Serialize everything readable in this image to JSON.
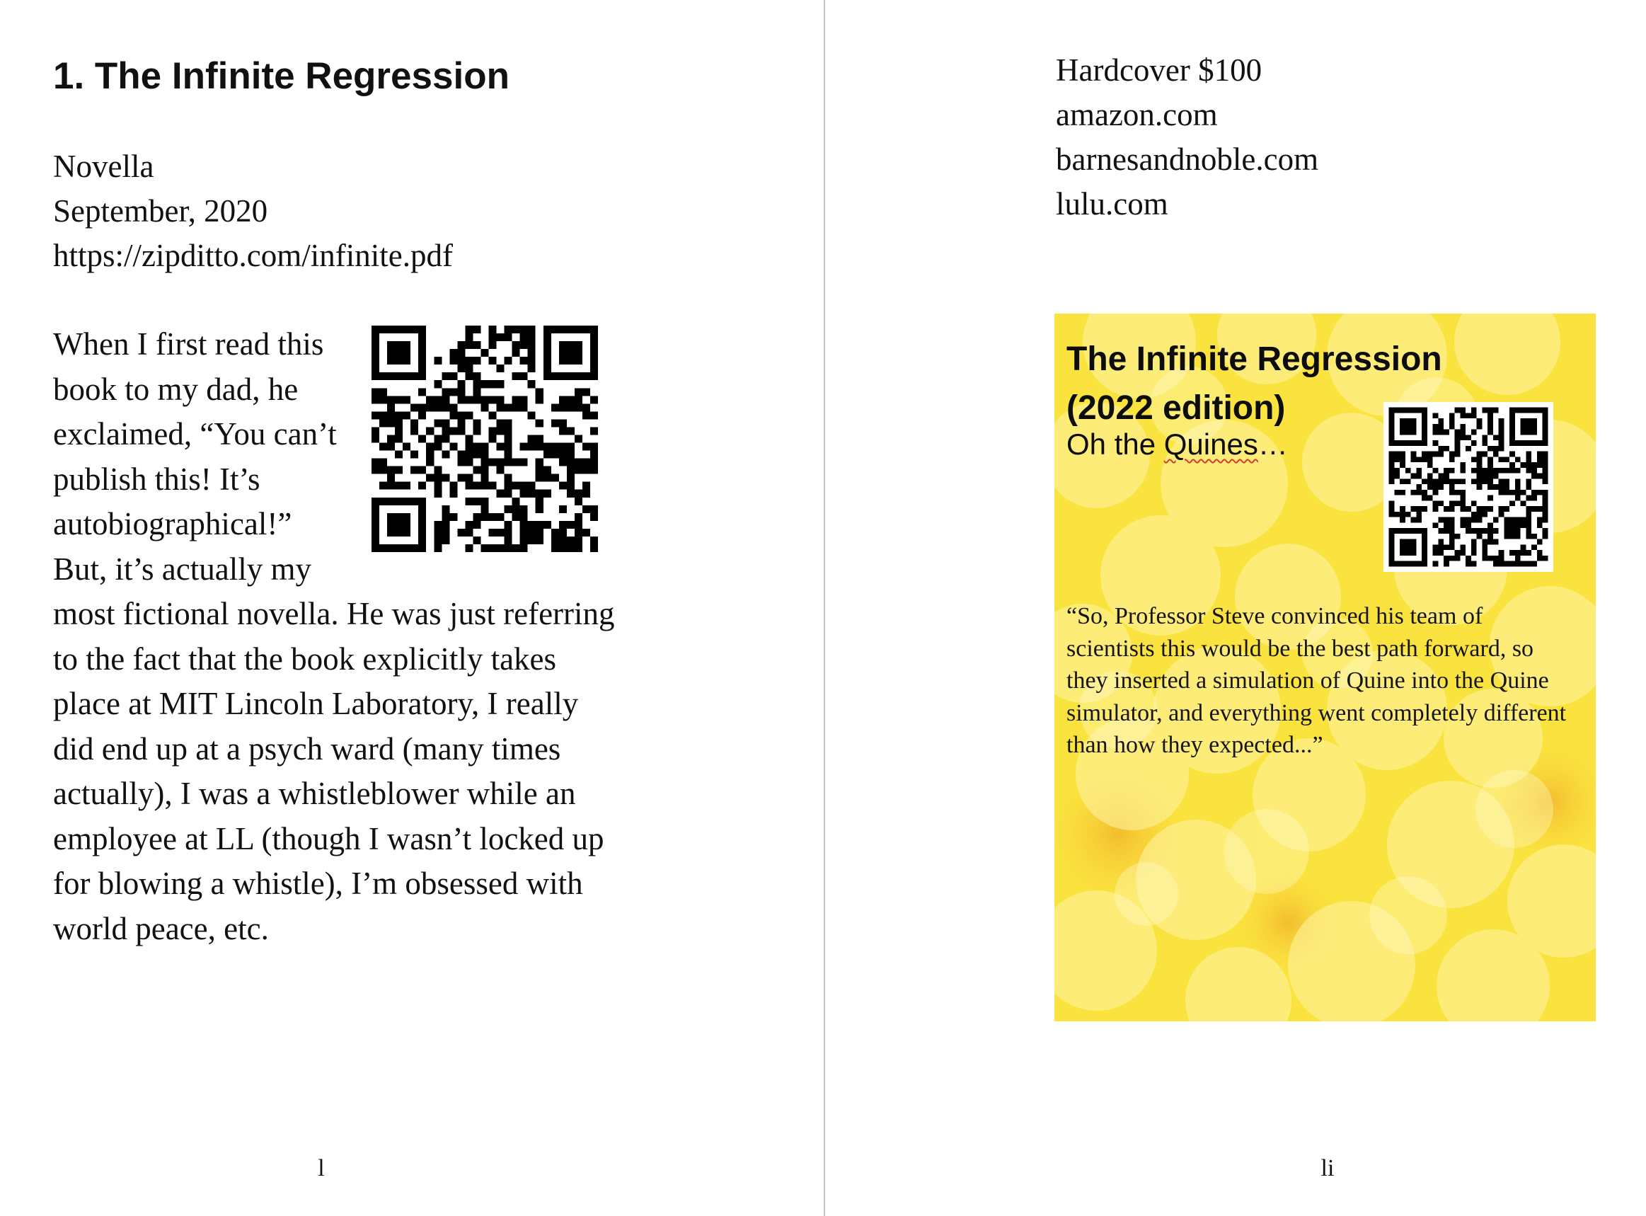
{
  "left_page": {
    "chapter_title": "1. The Infinite Regression",
    "meta": {
      "type": "Novella",
      "date": "September, 2020",
      "url": "https://zipditto.com/infinite.pdf"
    },
    "body": "When I first read this book to my dad, he exclaimed, “You can’t publish this! It’s autobiographical!” But, it’s actually my most fictional novella. He was just referring to the fact that the book explicitly takes place at MIT Lincoln Laboratory, I really did end up at a psych ward (many times actually), I was a whistleblower while an employee at LL (though I wasn’t locked up for blowing a whistle), I’m obsessed with world peace, etc.",
    "qr_icon": "qr-code-icon",
    "page_number": "l"
  },
  "right_page": {
    "buy": {
      "format": "Hardcover $100",
      "stores": [
        "amazon.com",
        "barnesandnoble.com",
        "lulu.com"
      ]
    },
    "cover": {
      "title_line1": "The Infinite Regression",
      "title_line2": "(2022 edition)",
      "subtitle_before": "Oh the ",
      "subtitle_squiggle": "Quines",
      "subtitle_after": "…",
      "quote": "“So, Professor Steve convinced his team of scientists this would be the best path forward, so they inserted a simulation of Quine into the Quine simulator, and everything went completely different than how they expected...”",
      "background_color": "#fbe544",
      "qr_icon": "qr-code-icon"
    },
    "page_number": "li"
  }
}
